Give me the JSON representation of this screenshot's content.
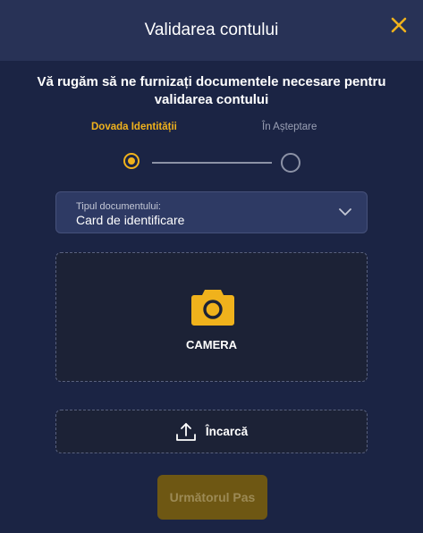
{
  "header": {
    "title": "Validarea contului"
  },
  "subtitle": "Vă rugăm să ne furnizați documentele necesare pentru validarea contului",
  "steps": [
    {
      "label": "Dovada Identității",
      "state": "active"
    },
    {
      "label": "În Așteptare",
      "state": "pending"
    }
  ],
  "document_select": {
    "label": "Tipul documentului:",
    "value": "Card de identificare"
  },
  "camera": {
    "label": "CAMERA",
    "icon": "camera-icon"
  },
  "upload": {
    "label": "Încarcă",
    "icon": "upload-icon"
  },
  "next_button": {
    "label": "Următorul Pas",
    "disabled": true
  },
  "colors": {
    "accent": "#f0b21c",
    "background": "#1b2444",
    "header": "#283256",
    "button_disabled": "#6e5713"
  }
}
